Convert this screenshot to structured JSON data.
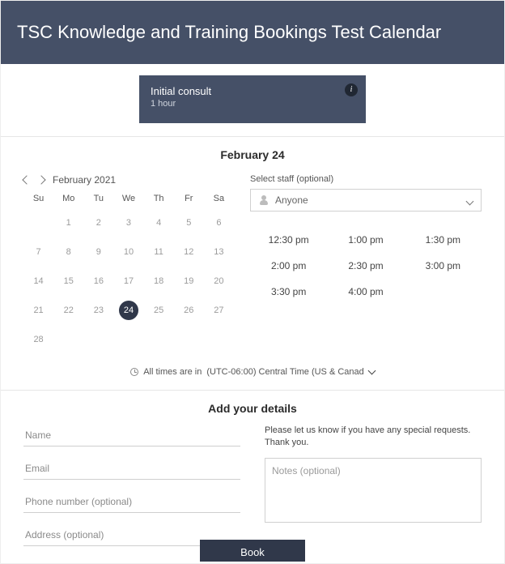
{
  "header": {
    "title": "TSC Knowledge and Training Bookings Test Calendar"
  },
  "service": {
    "name": "Initial consult",
    "duration": "1 hour",
    "info_icon": "i"
  },
  "selected_date_heading": "February 24",
  "calendar": {
    "prev_icon": "chevron-left",
    "next_icon": "chevron-right",
    "month_label": "February 2021",
    "weekdays": [
      "Su",
      "Mo",
      "Tu",
      "We",
      "Th",
      "Fr",
      "Sa"
    ],
    "weeks": [
      [
        "",
        "1",
        "2",
        "3",
        "4",
        "5",
        "6"
      ],
      [
        "7",
        "8",
        "9",
        "10",
        "11",
        "12",
        "13"
      ],
      [
        "14",
        "15",
        "16",
        "17",
        "18",
        "19",
        "20"
      ],
      [
        "21",
        "22",
        "23",
        "24",
        "25",
        "26",
        "27"
      ],
      [
        "28",
        "",
        "",
        "",
        "",
        "",
        ""
      ]
    ],
    "selected_day": "24"
  },
  "staff": {
    "label": "Select staff (optional)",
    "selected": "Anyone"
  },
  "times": {
    "slots": [
      "12:30 pm",
      "1:00 pm",
      "1:30 pm",
      "2:00 pm",
      "2:30 pm",
      "3:00 pm",
      "3:30 pm",
      "4:00 pm",
      ""
    ]
  },
  "timezone": {
    "prefix": "All times are in",
    "value": "(UTC-06:00) Central Time (US & Canad"
  },
  "details": {
    "heading": "Add your details",
    "name_ph": "Name",
    "email_ph": "Email",
    "phone_ph": "Phone number (optional)",
    "address_ph": "Address (optional)",
    "notes_message": "Please let us know if you have any special requests. Thank you.",
    "notes_ph": "Notes (optional)"
  },
  "book_button": "Book"
}
